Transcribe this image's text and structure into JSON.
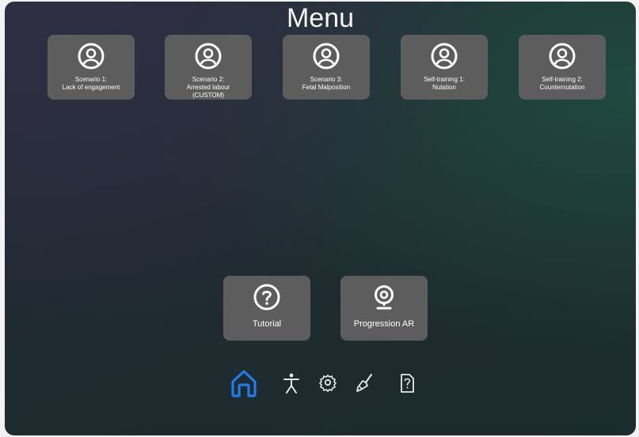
{
  "header": {
    "title": "Menu"
  },
  "scenarios": [
    {
      "label": "Scenario 1:\nLack of engagement",
      "icon": "user-circle-icon"
    },
    {
      "label": "Scenario 2:\nArrested labour\n(CUSTOM)",
      "icon": "user-circle-icon"
    },
    {
      "label": "Scenario 3:\nFetal Malposition",
      "icon": "user-circle-icon"
    },
    {
      "label": "Self-training 1:\nNutation",
      "icon": "user-circle-icon"
    },
    {
      "label": "Self-training 2:\nCounternutation",
      "icon": "user-circle-icon"
    }
  ],
  "actions": {
    "tutorial": {
      "label": "Tutorial",
      "icon": "question-circle-icon"
    },
    "progression": {
      "label": "Progression AR",
      "icon": "webcam-icon"
    }
  },
  "nav": {
    "items": [
      {
        "name": "home",
        "icon": "home-icon",
        "active": true
      },
      {
        "name": "accessibility",
        "icon": "accessibility-icon",
        "active": false
      },
      {
        "name": "settings",
        "icon": "gear-icon",
        "active": false
      },
      {
        "name": "tools",
        "icon": "brush-icon",
        "active": false
      },
      {
        "name": "help",
        "icon": "help-document-icon",
        "active": false
      }
    ],
    "active_color": "#1e7cf0",
    "inactive_color": "#e8e8e8"
  },
  "colors": {
    "card_background": "#5e5d5d",
    "text": "#ffffff"
  }
}
